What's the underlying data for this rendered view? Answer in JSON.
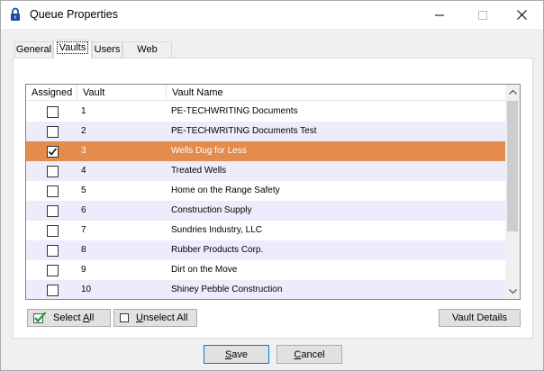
{
  "window": {
    "title": "Queue Properties",
    "icon": "lock-icon"
  },
  "tabs": [
    {
      "label": "General",
      "active": false
    },
    {
      "label": "Vaults",
      "active": true
    },
    {
      "label": "Users",
      "active": false
    },
    {
      "label": "Web Users",
      "active": false
    }
  ],
  "list": {
    "columns": [
      "Assigned",
      "Vault",
      "Vault Name"
    ],
    "rows": [
      {
        "assigned": false,
        "vault": "1",
        "name": "PE-TECHWRITING Documents"
      },
      {
        "assigned": false,
        "vault": "2",
        "name": "PE-TECHWRITING Documents Test"
      },
      {
        "assigned": true,
        "vault": "3",
        "name": "Wells Dug for Less",
        "selected": true
      },
      {
        "assigned": false,
        "vault": "4",
        "name": "Treated Wells"
      },
      {
        "assigned": false,
        "vault": "5",
        "name": "Home on the Range Safety"
      },
      {
        "assigned": false,
        "vault": "6",
        "name": "Construction Supply"
      },
      {
        "assigned": false,
        "vault": "7",
        "name": "Sundries Industry, LLC"
      },
      {
        "assigned": false,
        "vault": "8",
        "name": "Rubber Products Corp."
      },
      {
        "assigned": false,
        "vault": "9",
        "name": "Dirt on the Move"
      },
      {
        "assigned": false,
        "vault": "10",
        "name": "Shiney Pebble Construction"
      }
    ]
  },
  "buttons": {
    "select_all": {
      "prefix": "Select ",
      "mnemonic": "A",
      "suffix": "ll"
    },
    "unselect_all": {
      "prefix": "",
      "mnemonic": "U",
      "suffix": "nselect All"
    },
    "vault_details": "Vault Details",
    "save": {
      "mnemonic": "S",
      "suffix": "ave"
    },
    "cancel": {
      "mnemonic": "C",
      "suffix": "ancel"
    }
  },
  "colors": {
    "selected_row": "#e58b4c",
    "alt_row": "#ececfd",
    "check_green": "#2e9e2e"
  }
}
